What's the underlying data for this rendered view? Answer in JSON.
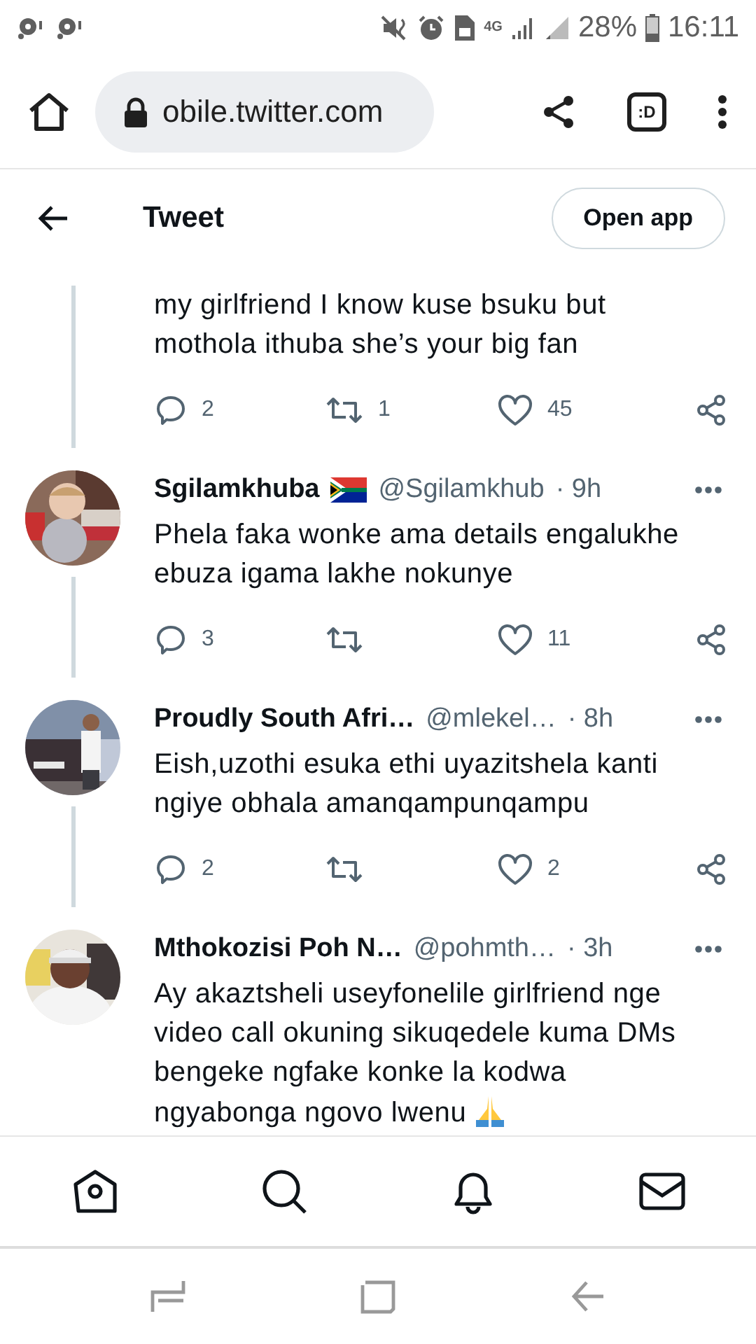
{
  "status_bar": {
    "network": "4G",
    "battery": "28%",
    "time": "16:11"
  },
  "browser": {
    "url": "obile.twitter.com",
    "tabs_button": ":D"
  },
  "header": {
    "title": "Tweet",
    "button": "Open app"
  },
  "tweets": [
    {
      "text": "my girlfriend I know kuse bsuku but mothola ithuba she’s your big fan",
      "stats": {
        "replies": "2",
        "retweets": "1",
        "likes": "45"
      },
      "thread_below": true
    },
    {
      "name": "Sgilamkhuba",
      "flag": true,
      "handle": "@Sgilamkhub",
      "time": "· 9h",
      "text": "Phela faka wonke ama details engalukhe ebuza igama lakhe nokunye",
      "stats": {
        "replies": "3",
        "likes": "11"
      },
      "thread_below": true
    },
    {
      "name": "Proudly South Afri…",
      "flag": false,
      "handle": "@mlekel…",
      "time": "· 8h",
      "text": "Eish,uzothi esuka ethi uyazitshela kanti ngiye obhala amanqampunqampu",
      "stats": {
        "replies": "2",
        "likes": "2"
      },
      "thread_below": true
    },
    {
      "name": "Mthokozisi Poh N…",
      "flag": false,
      "handle": "@pohmth…",
      "time": "· 3h",
      "text": "Ay akaztsheli useyfonelile girlfriend nge video call okuning sikuqedele kuma DMs bengeke ngfake konke la kodwa ngyabonga ngovo lwenu",
      "emoji": true,
      "thread_below": false
    }
  ]
}
